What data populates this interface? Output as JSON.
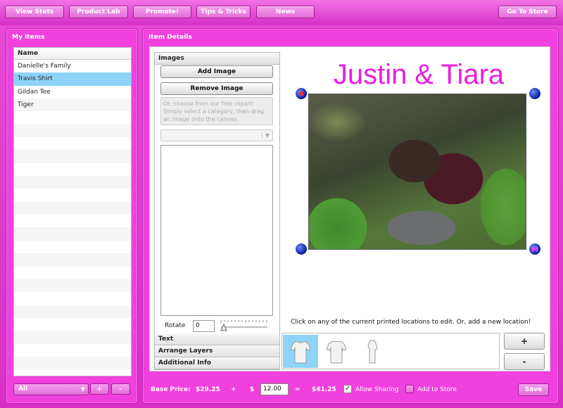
{
  "nav": {
    "view_stats": "View Stats",
    "product_lab": "Product Lab",
    "promote": "Promote!",
    "tips": "Tips & Tricks",
    "news": "News",
    "store": "Go To Store"
  },
  "my_items": {
    "title": "My Items",
    "column": "Name",
    "items": [
      "Danielle's Family",
      "Travis Shirt",
      "Gildan Tee",
      "Tiger"
    ],
    "selected_index": 1,
    "filter": "All",
    "add_label": "+",
    "remove_label": "-"
  },
  "details": {
    "title": "Item Details",
    "images_header": "Images",
    "add_image": "Add Image",
    "remove_image": "Remove Image",
    "clipart_hint": "Or, choose from our free clipart! Simply select a category, then drag an image onto the canvas.",
    "rotate_label": "Rotate",
    "rotate_value": "0",
    "text_header": "Text",
    "layers_header": "Arrange Layers",
    "info_header": "Additional Info",
    "canvas_text": "Justin & Tiara",
    "location_hint": "Click on any of the current printed locations to edit.  Or, add a new location!",
    "add_location": "+",
    "remove_location": "-"
  },
  "footer": {
    "base_price_label": "Base Price:",
    "base_price": "$29.25",
    "plus": "+",
    "dollar": "$",
    "markup": "12.00",
    "equals": "=",
    "total": "$41.25",
    "allow_sharing": "Allow Sharing",
    "allow_sharing_checked": true,
    "add_to_store": "Add to Store",
    "add_to_store_checked": false,
    "save": "Save"
  },
  "colors": {
    "accent": "#e81ee0",
    "selection": "#8ed3f8",
    "handle": "#0a1a9a"
  }
}
